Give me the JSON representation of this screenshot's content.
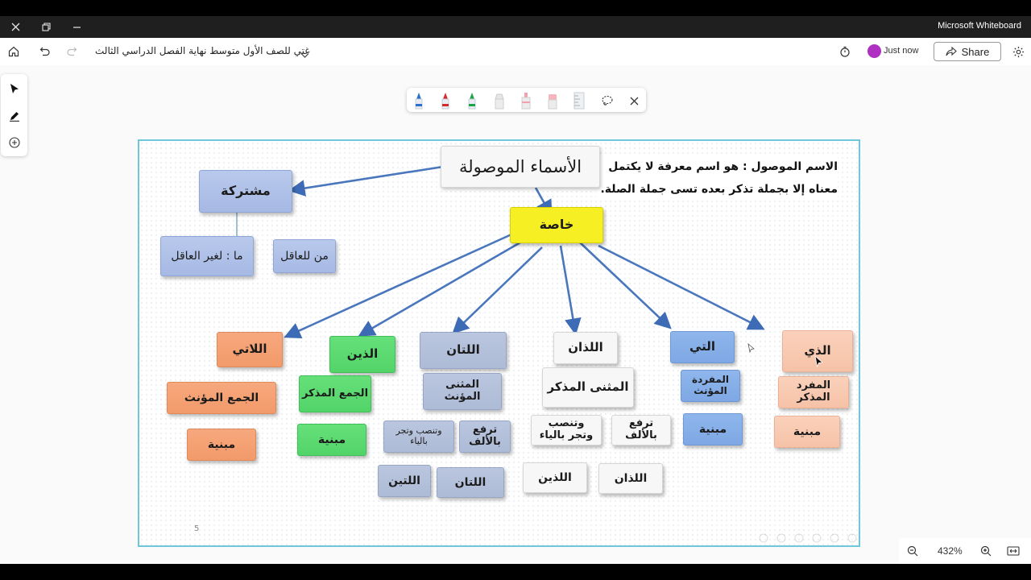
{
  "app": {
    "name": "Microsoft Whiteboard",
    "document_title": "غتي للصف الأول متوسط نهاية الفصل الدراسي الثالث",
    "presence_status": "Just now",
    "share_label": "Share",
    "zoom_level": "432%",
    "avatar_color": "#b02fc3"
  },
  "pens": [
    {
      "name": "blue-pen",
      "color": "#2a6fc9"
    },
    {
      "name": "red-pen",
      "color": "#d42a2a"
    },
    {
      "name": "green-pen",
      "color": "#1fa34a"
    },
    {
      "name": "white-pen",
      "color": "#dddddd"
    },
    {
      "name": "highlighter",
      "color": "#f2a0b0"
    },
    {
      "name": "eraser",
      "color": "#f7b4bd"
    }
  ],
  "slide": {
    "definition_line1": "الاسم الموصول : هو اسم معرفة لا يكتمل",
    "definition_line2": "معناه إلا بجملة تذكر بعده تسى جملة الصلة.",
    "page_number": "5",
    "root": "الأسماء الموصولة",
    "shared": {
      "label": "مشتركة",
      "ma": "ما : لغير العاقل",
      "man": "من للعاقل"
    },
    "special": "خاصة",
    "allati_pl": {
      "name": "اللاتي",
      "type": "الجمع المؤنث",
      "status": "مبنية"
    },
    "alladhina": {
      "name": "الذين",
      "type": "الجمع المذكر",
      "status": "مبنية"
    },
    "allatan": {
      "name": "اللتان",
      "type": "المثنى المؤنث",
      "raf": "ترفع بالألف",
      "nasb": "وتنصب وتجر بالياء",
      "form1": "اللتان",
      "form2": "اللتين"
    },
    "alladhan": {
      "name": "اللذان",
      "type": "المثنى المذكر",
      "raf": "ترفع بالألف",
      "nasb": "وتنصب وتجر بالياء",
      "form1": "اللذان",
      "form2": "اللذين"
    },
    "allati": {
      "name": "التي",
      "type": "المفردة المؤنث",
      "status": "مبنية"
    },
    "alladhi": {
      "name": "الذي",
      "type": "المفرد المذكر",
      "status": "مبنية"
    }
  }
}
